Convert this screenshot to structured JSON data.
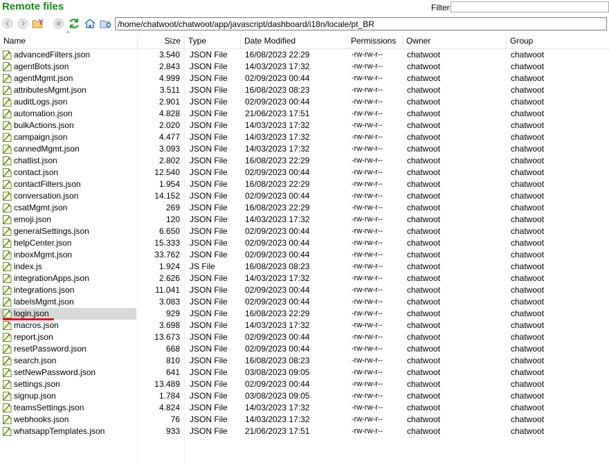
{
  "panel": {
    "title": "Remote files"
  },
  "filter": {
    "label": "Filter:",
    "value": ""
  },
  "toolbar": {
    "buttons": [
      {
        "name": "back-icon"
      },
      {
        "name": "forward-icon"
      },
      {
        "name": "folder-up-icon"
      },
      {
        "name": "stop-icon"
      },
      {
        "name": "refresh-icon"
      },
      {
        "name": "home-icon"
      },
      {
        "name": "new-folder-icon"
      }
    ]
  },
  "path": {
    "value": "/home/chatwoot/chatwoot/app/javascript/dashboard/i18n/locale/pt_BR"
  },
  "columns": [
    "Name",
    "Size",
    "Type",
    "Date Modified",
    "Permissions",
    "Owner",
    "Group"
  ],
  "selected_file": "login.json",
  "files": [
    {
      "name": "advancedFilters.json",
      "size": "3.540",
      "type": "JSON File",
      "date": "16/08/2023 22:29",
      "perm": "-rw-rw-r--",
      "owner": "chatwoot",
      "group": "chatwoot"
    },
    {
      "name": "agentBots.json",
      "size": "2.843",
      "type": "JSON File",
      "date": "14/03/2023 17:32",
      "perm": "-rw-rw-r--",
      "owner": "chatwoot",
      "group": "chatwoot"
    },
    {
      "name": "agentMgmt.json",
      "size": "4.999",
      "type": "JSON File",
      "date": "02/09/2023 00:44",
      "perm": "-rw-rw-r--",
      "owner": "chatwoot",
      "group": "chatwoot"
    },
    {
      "name": "attributesMgmt.json",
      "size": "3.511",
      "type": "JSON File",
      "date": "16/08/2023 08:23",
      "perm": "-rw-rw-r--",
      "owner": "chatwoot",
      "group": "chatwoot"
    },
    {
      "name": "auditLogs.json",
      "size": "2.901",
      "type": "JSON File",
      "date": "02/09/2023 00:44",
      "perm": "-rw-rw-r--",
      "owner": "chatwoot",
      "group": "chatwoot"
    },
    {
      "name": "automation.json",
      "size": "4.828",
      "type": "JSON File",
      "date": "21/06/2023 17:51",
      "perm": "-rw-rw-r--",
      "owner": "chatwoot",
      "group": "chatwoot"
    },
    {
      "name": "bulkActions.json",
      "size": "2.020",
      "type": "JSON File",
      "date": "14/03/2023 17:32",
      "perm": "-rw-rw-r--",
      "owner": "chatwoot",
      "group": "chatwoot"
    },
    {
      "name": "campaign.json",
      "size": "4.477",
      "type": "JSON File",
      "date": "14/03/2023 17:32",
      "perm": "-rw-rw-r--",
      "owner": "chatwoot",
      "group": "chatwoot"
    },
    {
      "name": "cannedMgmt.json",
      "size": "3.093",
      "type": "JSON File",
      "date": "14/03/2023 17:32",
      "perm": "-rw-rw-r--",
      "owner": "chatwoot",
      "group": "chatwoot"
    },
    {
      "name": "chatlist.json",
      "size": "2.802",
      "type": "JSON File",
      "date": "16/08/2023 22:29",
      "perm": "-rw-rw-r--",
      "owner": "chatwoot",
      "group": "chatwoot"
    },
    {
      "name": "contact.json",
      "size": "12.540",
      "type": "JSON File",
      "date": "02/09/2023 00:44",
      "perm": "-rw-rw-r--",
      "owner": "chatwoot",
      "group": "chatwoot"
    },
    {
      "name": "contactFilters.json",
      "size": "1.954",
      "type": "JSON File",
      "date": "16/08/2023 22:29",
      "perm": "-rw-rw-r--",
      "owner": "chatwoot",
      "group": "chatwoot"
    },
    {
      "name": "conversation.json",
      "size": "14.152",
      "type": "JSON File",
      "date": "02/09/2023 00:44",
      "perm": "-rw-rw-r--",
      "owner": "chatwoot",
      "group": "chatwoot"
    },
    {
      "name": "csatMgmt.json",
      "size": "269",
      "type": "JSON File",
      "date": "16/08/2023 22:29",
      "perm": "-rw-rw-r--",
      "owner": "chatwoot",
      "group": "chatwoot"
    },
    {
      "name": "emoji.json",
      "size": "120",
      "type": "JSON File",
      "date": "14/03/2023 17:32",
      "perm": "-rw-rw-r--",
      "owner": "chatwoot",
      "group": "chatwoot"
    },
    {
      "name": "generalSettings.json",
      "size": "6.650",
      "type": "JSON File",
      "date": "02/09/2023 00:44",
      "perm": "-rw-rw-r--",
      "owner": "chatwoot",
      "group": "chatwoot"
    },
    {
      "name": "helpCenter.json",
      "size": "15.333",
      "type": "JSON File",
      "date": "02/09/2023 00:44",
      "perm": "-rw-rw-r--",
      "owner": "chatwoot",
      "group": "chatwoot"
    },
    {
      "name": "inboxMgmt.json",
      "size": "33.762",
      "type": "JSON File",
      "date": "02/09/2023 00:44",
      "perm": "-rw-rw-r--",
      "owner": "chatwoot",
      "group": "chatwoot"
    },
    {
      "name": "index.js",
      "size": "1.924",
      "type": "JS File",
      "date": "16/08/2023 08:23",
      "perm": "-rw-rw-r--",
      "owner": "chatwoot",
      "group": "chatwoot"
    },
    {
      "name": "integrationApps.json",
      "size": "2.626",
      "type": "JSON File",
      "date": "14/03/2023 17:32",
      "perm": "-rw-rw-r--",
      "owner": "chatwoot",
      "group": "chatwoot"
    },
    {
      "name": "integrations.json",
      "size": "11.041",
      "type": "JSON File",
      "date": "02/09/2023 00:44",
      "perm": "-rw-rw-r--",
      "owner": "chatwoot",
      "group": "chatwoot"
    },
    {
      "name": "labelsMgmt.json",
      "size": "3.083",
      "type": "JSON File",
      "date": "02/09/2023 00:44",
      "perm": "-rw-rw-r--",
      "owner": "chatwoot",
      "group": "chatwoot"
    },
    {
      "name": "login.json",
      "size": "929",
      "type": "JSON File",
      "date": "16/08/2023 22:29",
      "perm": "-rw-rw-r--",
      "owner": "chatwoot",
      "group": "chatwoot"
    },
    {
      "name": "macros.json",
      "size": "3.698",
      "type": "JSON File",
      "date": "14/03/2023 17:32",
      "perm": "-rw-rw-r--",
      "owner": "chatwoot",
      "group": "chatwoot"
    },
    {
      "name": "report.json",
      "size": "13.673",
      "type": "JSON File",
      "date": "02/09/2023 00:44",
      "perm": "-rw-rw-r--",
      "owner": "chatwoot",
      "group": "chatwoot"
    },
    {
      "name": "resetPassword.json",
      "size": "668",
      "type": "JSON File",
      "date": "02/09/2023 00:44",
      "perm": "-rw-rw-r--",
      "owner": "chatwoot",
      "group": "chatwoot"
    },
    {
      "name": "search.json",
      "size": "810",
      "type": "JSON File",
      "date": "16/08/2023 08:23",
      "perm": "-rw-rw-r--",
      "owner": "chatwoot",
      "group": "chatwoot"
    },
    {
      "name": "setNewPassword.json",
      "size": "641",
      "type": "JSON File",
      "date": "03/08/2023 09:05",
      "perm": "-rw-rw-r--",
      "owner": "chatwoot",
      "group": "chatwoot"
    },
    {
      "name": "settings.json",
      "size": "13.489",
      "type": "JSON File",
      "date": "02/09/2023 00:44",
      "perm": "-rw-rw-r--",
      "owner": "chatwoot",
      "group": "chatwoot"
    },
    {
      "name": "signup.json",
      "size": "1.784",
      "type": "JSON File",
      "date": "03/08/2023 09:05",
      "perm": "-rw-rw-r--",
      "owner": "chatwoot",
      "group": "chatwoot"
    },
    {
      "name": "teamsSettings.json",
      "size": "4.824",
      "type": "JSON File",
      "date": "14/03/2023 17:32",
      "perm": "-rw-rw-r--",
      "owner": "chatwoot",
      "group": "chatwoot"
    },
    {
      "name": "webhooks.json",
      "size": "76",
      "type": "JSON File",
      "date": "14/03/2023 17:32",
      "perm": "-rw-rw-r--",
      "owner": "chatwoot",
      "group": "chatwoot"
    },
    {
      "name": "whatsappTemplates.json",
      "size": "933",
      "type": "JSON File",
      "date": "21/06/2023 17:51",
      "perm": "-rw-rw-r--",
      "owner": "chatwoot",
      "group": "chatwoot"
    }
  ],
  "colors": {
    "title": "#1a8a1a",
    "selection": "#d9d9d9",
    "annotation": "#e01010"
  }
}
